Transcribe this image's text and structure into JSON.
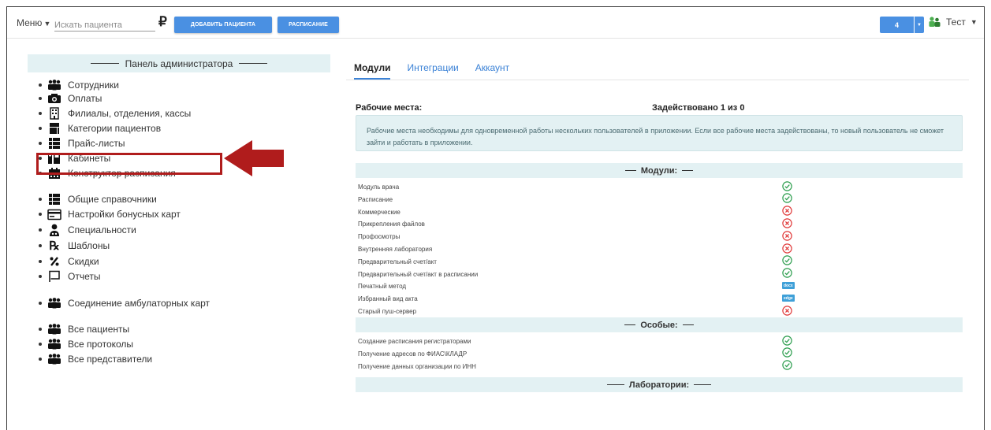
{
  "topbar": {
    "menu_label": "Меню",
    "search_placeholder": "Искать пациента",
    "currency_symbol": "₽",
    "add_patient_label": "ДОБАВИТЬ ПАЦИЕНТА",
    "schedule_label": "РАСПИСАНИЕ",
    "counter_value": "4",
    "user_name": "Тест"
  },
  "admin_panel": {
    "title": "Панель администратора",
    "items": [
      {
        "label": "Сотрудники",
        "icon": "users-icon"
      },
      {
        "label": "Оплаты",
        "icon": "camera-money-icon"
      },
      {
        "label": "Филиалы, отделения, кассы",
        "icon": "building-icon",
        "highlighted": true
      },
      {
        "label": "Категории пациентов",
        "icon": "patient-category-icon"
      },
      {
        "label": "Прайс-листы",
        "icon": "list-icon"
      },
      {
        "label": "Кабинеты",
        "icon": "door-icon"
      },
      {
        "label": "Конструктор расписания",
        "icon": "calendar-icon"
      },
      {
        "label": "Общие справочники",
        "icon": "list-icon"
      },
      {
        "label": "Настройки бонусных карт",
        "icon": "card-icon"
      },
      {
        "label": "Специальности",
        "icon": "doctor-icon"
      },
      {
        "label": "Шаблоны",
        "icon": "rx-icon"
      },
      {
        "label": "Скидки",
        "icon": "percent-icon"
      },
      {
        "label": "Отчеты",
        "icon": "flag-icon"
      },
      {
        "label": "Соединение амбулаторных карт",
        "icon": "users-icon"
      },
      {
        "label": "Все пациенты",
        "icon": "users-icon"
      },
      {
        "label": "Все протоколы",
        "icon": "users-icon"
      },
      {
        "label": "Все представители",
        "icon": "users-icon"
      }
    ]
  },
  "tabs": [
    {
      "label": "Модули",
      "active": true
    },
    {
      "label": "Интеграции",
      "active": false
    },
    {
      "label": "Аккаунт",
      "active": false
    }
  ],
  "workplaces": {
    "title": "Рабочие места:",
    "used": "Задействовано 1 из 0",
    "info": "Рабочие места необходимы для одновременной работы нескольких пользователей в приложении. Если все рабочие места задействованы, то новый пользователь не сможет зайти и работать в приложении."
  },
  "sections": {
    "modules": {
      "title": "Модули:",
      "rows": [
        {
          "label": "Модуль врача",
          "status": "ok"
        },
        {
          "label": "Расписание",
          "status": "ok"
        },
        {
          "label": "Коммерческие",
          "status": "off"
        },
        {
          "label": "Прикрепления файлов",
          "status": "off"
        },
        {
          "label": "Профосмотры",
          "status": "off"
        },
        {
          "label": "Внутренняя лаборатория",
          "status": "off"
        },
        {
          "label": "Предварительный счет/акт",
          "status": "ok"
        },
        {
          "label": "Предварительный счет/акт в расписании",
          "status": "ok"
        },
        {
          "label": "Печатный метод",
          "status": "badge",
          "badge": "docx"
        },
        {
          "label": "Избранный вид акта",
          "status": "badge",
          "badge": "edge"
        },
        {
          "label": "Старый пуш-сервер",
          "status": "off"
        }
      ]
    },
    "special": {
      "title": "Особые:",
      "rows": [
        {
          "label": "Создание расписания регистраторами",
          "status": "ok"
        },
        {
          "label": "Получение адресов по ФИАС\\КЛАДР",
          "status": "ok"
        },
        {
          "label": "Получение данных организации по ИНН",
          "status": "ok"
        }
      ]
    },
    "labs": {
      "title": "Лаборатории:"
    }
  },
  "colors": {
    "accent": "#4a90e2",
    "ok": "#2e9e4f",
    "off": "#e03a3a",
    "section_bg": "#e3f1f3",
    "highlight": "#b01c1c"
  }
}
